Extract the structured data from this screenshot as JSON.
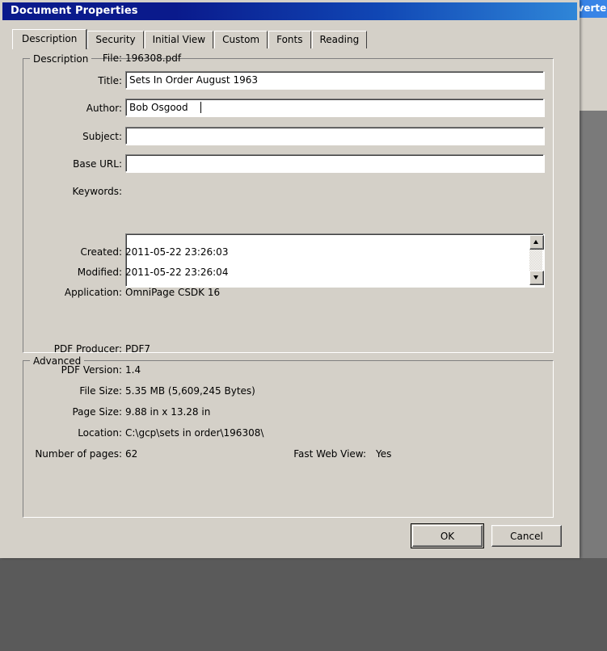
{
  "background": {
    "app_title_fragment": "nverter",
    "icons": [
      "pdf-document-icon",
      "blank-page-icon",
      "compare-documents-icon",
      "dropdown-arrow-icon"
    ]
  },
  "dialog": {
    "title": "Document Properties",
    "tabs": [
      {
        "label": "Description",
        "selected": true
      },
      {
        "label": "Security",
        "selected": false
      },
      {
        "label": "Initial View",
        "selected": false
      },
      {
        "label": "Custom",
        "selected": false
      },
      {
        "label": "Fonts",
        "selected": false
      },
      {
        "label": "Reading",
        "selected": false
      }
    ],
    "description_group": {
      "legend": "Description",
      "file_label": "File:",
      "file_value": "196308.pdf",
      "title_label": "Title:",
      "title_value": "Sets In Order August 1963",
      "author_label": "Author:",
      "author_value": "Bob Osgood ",
      "subject_label": "Subject:",
      "subject_value": "",
      "base_url_label": "Base URL:",
      "base_url_value": "",
      "keywords_label": "Keywords:",
      "keywords_value": "",
      "created_label": "Created:",
      "created_value": "2011-05-22 23:26:03",
      "modified_label": "Modified:",
      "modified_value": "2011-05-22 23:26:04",
      "application_label": "Application:",
      "application_value": "OmniPage CSDK 16"
    },
    "advanced_group": {
      "legend": "Advanced",
      "pdf_producer_label": "PDF Producer:",
      "pdf_producer_value": "PDF7",
      "pdf_version_label": "PDF Version:",
      "pdf_version_value": "1.4",
      "file_size_label": "File Size:",
      "file_size_value": "5.35 MB (5,609,245 Bytes)",
      "page_size_label": "Page Size:",
      "page_size_value": "9.88 in x 13.28 in",
      "location_label": "Location:",
      "location_value": "C:\\gcp\\sets in order\\196308\\",
      "number_of_pages_label": "Number of pages:",
      "number_of_pages_value": "62",
      "fast_web_view_label": "Fast Web View:",
      "fast_web_view_value": "Yes"
    },
    "buttons": {
      "ok": "OK",
      "cancel": "Cancel"
    }
  },
  "colors": {
    "dialog_face": "#d4d0c8",
    "titlebar_start": "#0a1a8c",
    "titlebar_end": "#2f86d8",
    "field_background": "#ffffff"
  }
}
